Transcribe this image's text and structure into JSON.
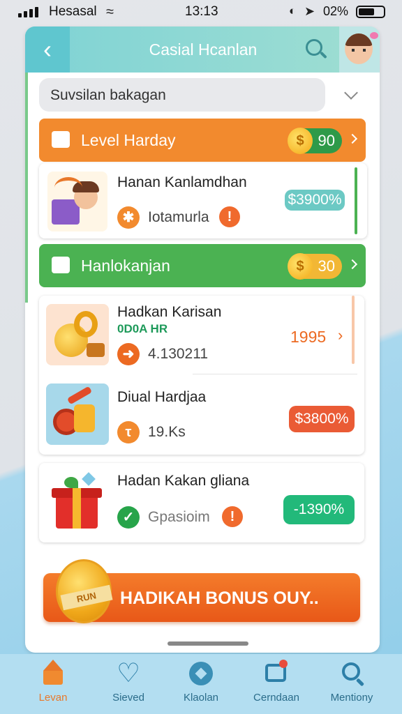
{
  "status_bar": {
    "carrier": "Hesasal",
    "time": "13:13",
    "battery": "02%"
  },
  "header": {
    "title": "Casial Hcanlan"
  },
  "search": {
    "text": "Suvsilan bakagan"
  },
  "sections": [
    {
      "title": "Level Harday",
      "points": "90",
      "color": "#f28a2e"
    },
    {
      "title": "Hanlokanjan",
      "points": "30",
      "color": "#4bb252"
    }
  ],
  "items": [
    {
      "title": "Hanan Kanlamdhan",
      "sub": "Iotamurla",
      "price": "$3900%",
      "price_color": "#6cc9c4"
    },
    {
      "title": "Hadkan Karisan",
      "tag": "0D0A HR",
      "sub": "4.130211",
      "value": "1995"
    },
    {
      "title": "Diual Hardjaa",
      "sub": "19.Ks",
      "price": "$3800%",
      "price_color": "#ea5b35"
    },
    {
      "title": "Hadan Kakan gliana",
      "sub": "Gpasioim",
      "price": "-1390%",
      "price_color": "#22b97a"
    }
  ],
  "bonus": {
    "label": "HADIKAH BONUS OUY..",
    "coin_text": "RUN"
  },
  "nav": [
    {
      "label": "Levan",
      "icon": "home-icon",
      "active": true
    },
    {
      "label": "Sieved",
      "icon": "heart-icon",
      "active": false
    },
    {
      "label": "Klaolan",
      "icon": "compass-icon",
      "active": false
    },
    {
      "label": "Cerndaan",
      "icon": "chat-icon",
      "active": false
    },
    {
      "label": "Mentiony",
      "icon": "search-icon",
      "active": false
    }
  ]
}
